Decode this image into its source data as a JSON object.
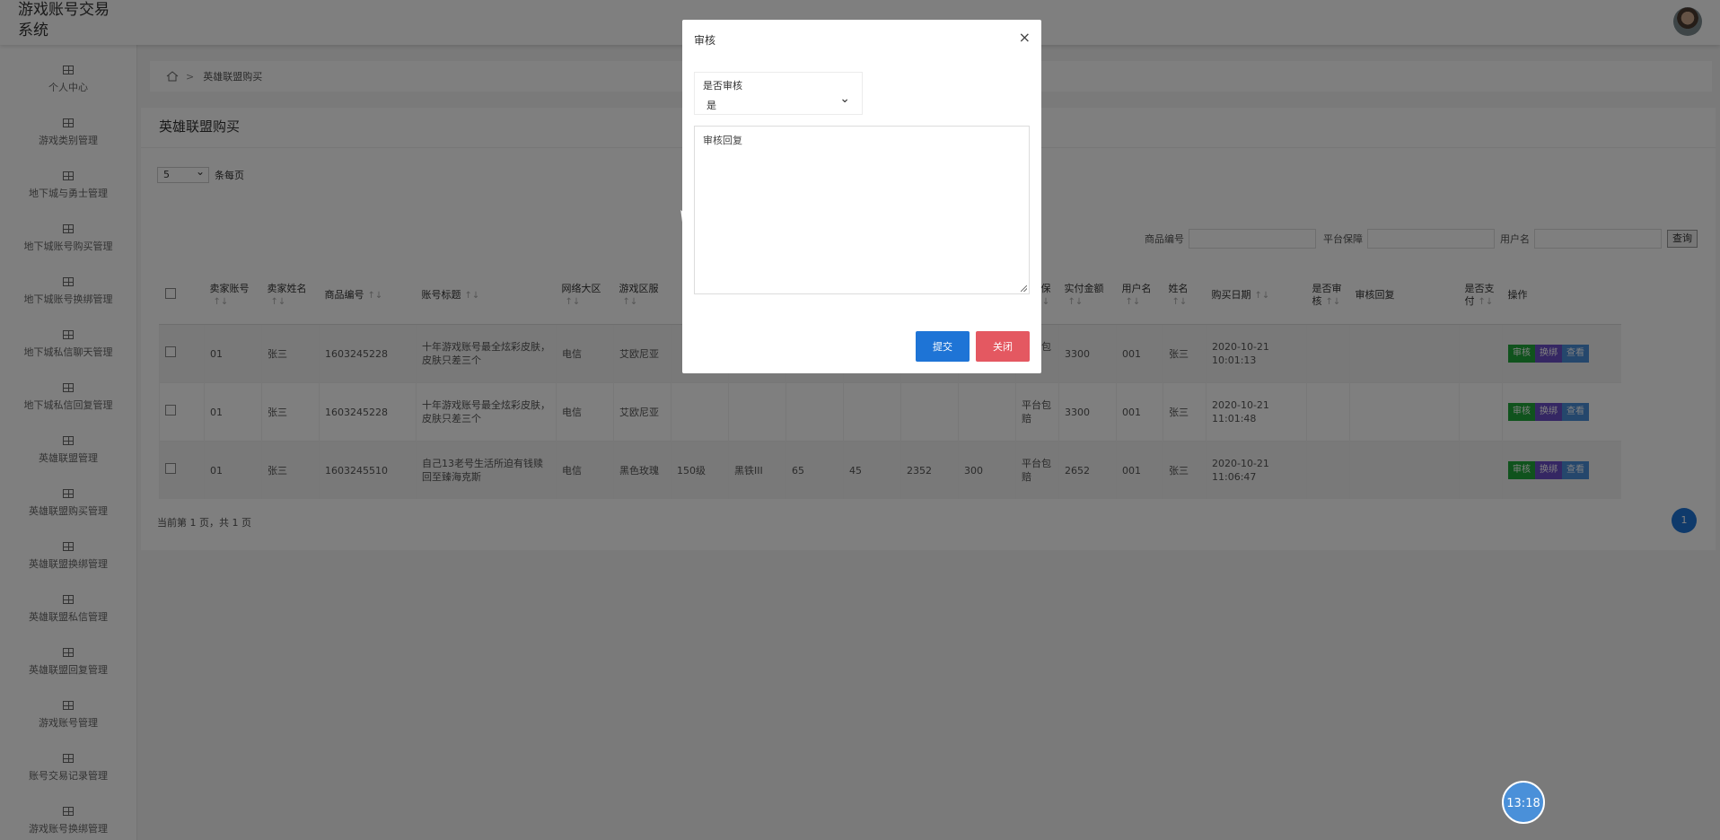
{
  "app": {
    "title_line1": "游戏账号交易",
    "title_line2": "系统"
  },
  "sidebar": {
    "items": [
      {
        "label": "个人中心"
      },
      {
        "label": "游戏类别管理"
      },
      {
        "label": "地下城与勇士管理"
      },
      {
        "label": "地下城账号购买管理"
      },
      {
        "label": "地下城账号换绑管理"
      },
      {
        "label": "地下城私信聊天管理"
      },
      {
        "label": "地下城私信回复管理"
      },
      {
        "label": "英雄联盟管理"
      },
      {
        "label": "英雄联盟购买管理"
      },
      {
        "label": "英雄联盟换绑管理"
      },
      {
        "label": "英雄联盟私信管理"
      },
      {
        "label": "英雄联盟回复管理"
      },
      {
        "label": "游戏账号管理"
      },
      {
        "label": "账号交易记录管理"
      },
      {
        "label": "游戏账号换绑管理"
      }
    ]
  },
  "breadcrumb": {
    "current": "英雄联盟购买",
    "separator": ">"
  },
  "panel": {
    "title": "英雄联盟购买",
    "page_size_value": "5",
    "page_size_suffix": "条每页",
    "search": {
      "product_no_label": "商品编号",
      "platform_label": "平台保障",
      "username_label": "用户名",
      "query_button": "查询"
    },
    "footer": "当前第 1 页，共 1 页",
    "current_page": "1"
  },
  "table": {
    "headers": {
      "seller_account": "卖家账号",
      "seller_name": "卖家姓名",
      "product_no": "商品编号",
      "account_title": "账号标题",
      "network": "网络大区",
      "game_server": "游戏区服",
      "platform": "平台保障",
      "paid": "实付金额",
      "username": "用户名",
      "name": "姓名",
      "buy_date": "购买日期",
      "is_reviewed": "是否审核",
      "review_reply": "审核回复",
      "is_paid": "是否支付",
      "actions": "操作"
    },
    "rows": [
      {
        "seller_account": "01",
        "seller_name": "张三",
        "product_no": "1603245228",
        "title": "十年游戏账号最全炫彩皮肤，皮肤只差三个",
        "network": "电信",
        "server": "艾欧尼亚",
        "level": "",
        "rank": "",
        "c1": "",
        "c2": "",
        "c3": "",
        "c4": "",
        "platform": "平台包赔",
        "paid": "3300",
        "username": "001",
        "name": "张三",
        "date": "2020-10-21 10:01:13"
      },
      {
        "seller_account": "01",
        "seller_name": "张三",
        "product_no": "1603245228",
        "title": "十年游戏账号最全炫彩皮肤，皮肤只差三个",
        "network": "电信",
        "server": "艾欧尼亚",
        "level": "",
        "rank": "",
        "c1": "",
        "c2": "",
        "c3": "",
        "c4": "",
        "platform": "平台包赔",
        "paid": "3300",
        "username": "001",
        "name": "张三",
        "date": "2020-10-21 11:01:48"
      },
      {
        "seller_account": "01",
        "seller_name": "张三",
        "product_no": "1603245510",
        "title": "自己13老号生活所迫有钱赎回至臻海克斯",
        "network": "电信",
        "server": "黑色玫瑰",
        "level": "150级",
        "rank": "黑铁III",
        "c1": "65",
        "c2": "45",
        "c3": "2352",
        "c4": "300",
        "platform": "平台包赔",
        "paid": "2652",
        "username": "001",
        "name": "张三",
        "date": "2020-10-21 11:06:47"
      }
    ],
    "actions": {
      "review": "审核",
      "rebind": "换绑",
      "view": "查看"
    }
  },
  "modal": {
    "title": "审核",
    "select_label": "是否审核",
    "select_value": "是",
    "reply_placeholder": "审核回复",
    "submit": "提交",
    "close": "关闭"
  },
  "clock": {
    "time": "13:18"
  }
}
